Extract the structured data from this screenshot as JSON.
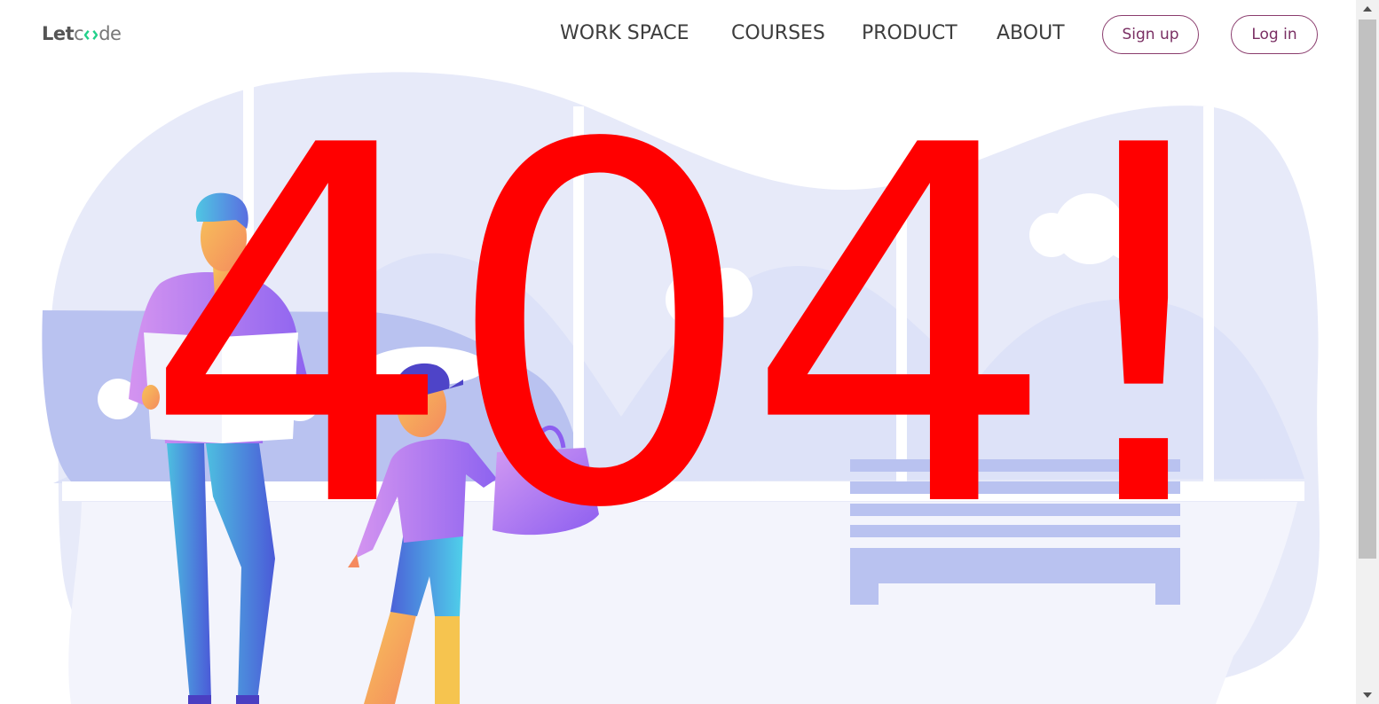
{
  "brand": {
    "logo_prefix": "Let",
    "logo_suffix": "de",
    "accent": "#23d18b"
  },
  "nav": {
    "items": [
      {
        "label": "WORK SPACE"
      },
      {
        "label": "COURSES"
      },
      {
        "label": "PRODUCT"
      },
      {
        "label": "ABOUT"
      }
    ],
    "signup_label": "Sign up",
    "login_label": "Log in"
  },
  "error": {
    "text": "404!",
    "color": "#ff0000"
  },
  "icons": {
    "logo_glyph": "code-brackets-icon",
    "scroll_up": "triangle-up-icon",
    "scroll_down": "triangle-down-icon"
  }
}
